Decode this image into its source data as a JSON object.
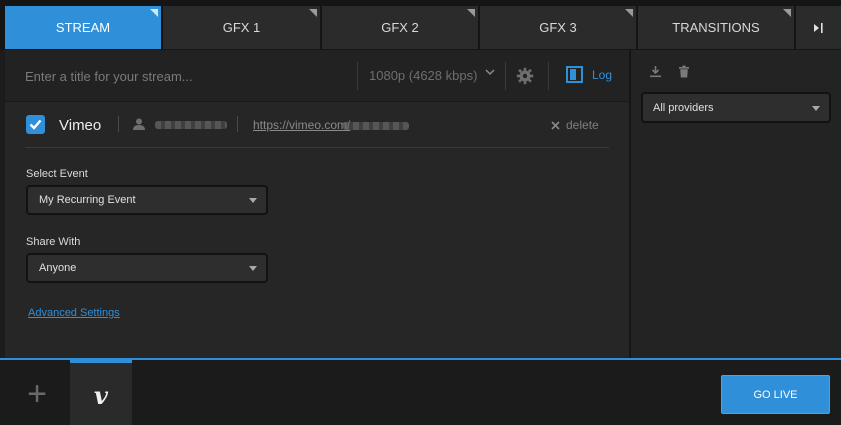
{
  "tabs": [
    {
      "label": "STREAM",
      "active": true
    },
    {
      "label": "GFX 1",
      "active": false
    },
    {
      "label": "GFX 2",
      "active": false
    },
    {
      "label": "GFX 3",
      "active": false
    },
    {
      "label": "TRANSITIONS",
      "active": false
    }
  ],
  "tab_end_icon": "skip-to-end-icon",
  "stream": {
    "title_placeholder": "Enter a title for your stream...",
    "quality": "1080p (4628 kbps)",
    "log_label": "Log"
  },
  "provider": {
    "checked": true,
    "name": "Vimeo",
    "url_visible": "https://vimeo.com/",
    "delete_label": "delete"
  },
  "fields": {
    "event_label": "Select Event",
    "event_value": "My Recurring Event",
    "share_label": "Share With",
    "share_value": "Anyone",
    "advanced_label": "Advanced Settings"
  },
  "right_panel": {
    "providers_value": "All providers"
  },
  "bottom": {
    "add_symbol": "+",
    "vimeo_symbol": "v",
    "golive_label": "GO LIVE"
  },
  "colors": {
    "accent": "#2f8fd8",
    "background": "#1c1c1c",
    "panel": "#262626"
  }
}
